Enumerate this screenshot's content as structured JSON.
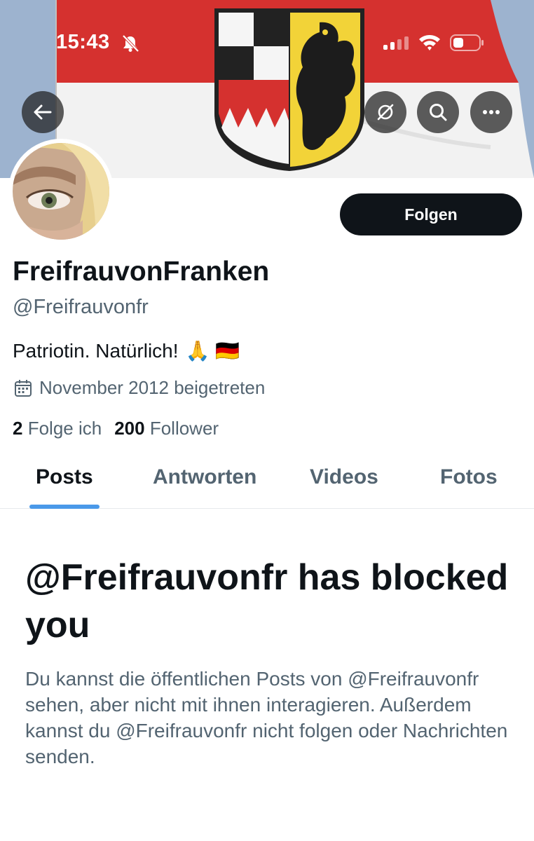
{
  "status_bar": {
    "time": "15:43"
  },
  "banner": {
    "colors": {
      "flag_red": "#d5312f",
      "flag_white": "#f4f4f4",
      "coat_yellow": "#f2d338"
    }
  },
  "profile": {
    "display_name": "FreifrauvonFranken",
    "handle": "@Freifrauvonfr",
    "bio": "Patriotin. Natürlich!",
    "bio_emojis": "🙏 🇩🇪",
    "joined": "November 2012 beigetreten",
    "following_count": "2",
    "following_label": "Folge ich",
    "followers_count": "200",
    "followers_label": "Follower"
  },
  "actions": {
    "follow_label": "Folgen"
  },
  "tabs": [
    {
      "label": "Posts",
      "active": true
    },
    {
      "label": "Antworten",
      "active": false
    },
    {
      "label": "Videos",
      "active": false
    },
    {
      "label": "Fotos",
      "active": false
    }
  ],
  "blocked": {
    "title": "@Freifrauvonfr has blocked you",
    "description": "Du kannst die öffentlichen Posts von @Freifrauvonfr sehen, aber nicht mit ihnen interagieren. Außerdem kannst du @Freifrauvonfr nicht folgen oder Nachrichten senden."
  },
  "theme": {
    "accent": "#4a99e9",
    "text": "#0f1419",
    "secondary": "#536471"
  }
}
